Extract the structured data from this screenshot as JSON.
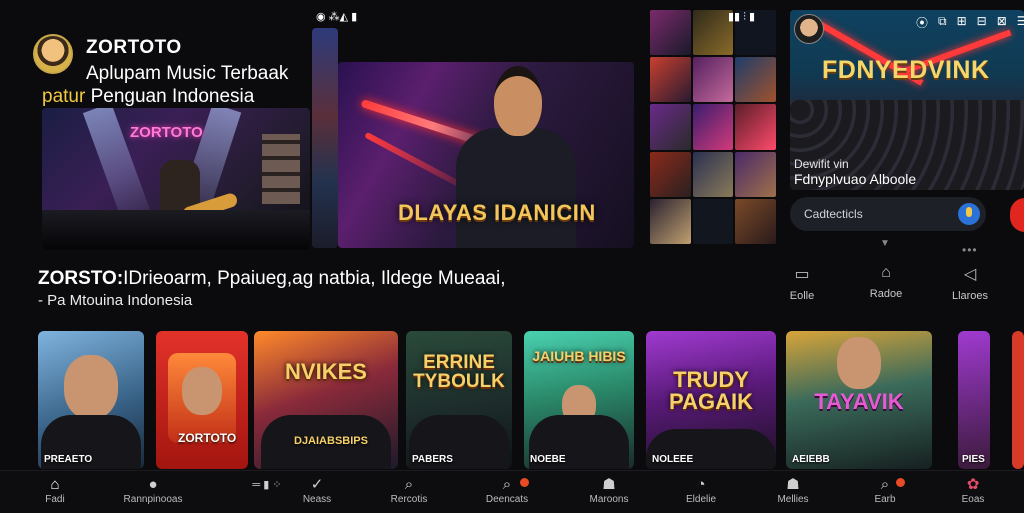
{
  "header": {
    "brand": "ZORTOTO",
    "tagline_1": "Aplupam Music Terbaak",
    "tagline_2_prefix": "patur",
    "tagline_2_rest": "Penguan Indonesia"
  },
  "hero_main": {
    "sign": "ZORTOTO"
  },
  "status_mid": "◉ ⁂◭ ▮",
  "hero_feature": {
    "title": "DLAYAS IDANICIN"
  },
  "status_grid": "▮▮ ⫶ ▮",
  "right_panel": {
    "banner": "FDNYEDVINK",
    "sub_1": "Dewifit vin",
    "sub_2": "Fdnyplvuao Alboole",
    "icons": [
      "⦿",
      "⧉",
      "⊞",
      "⊟",
      "⊠",
      "☰",
      "⊡"
    ],
    "search_placeholder": "Cadtecticls"
  },
  "quick_actions": [
    {
      "icon": "▭",
      "label": "Eolle"
    },
    {
      "icon": "⌂",
      "label": "Radoe"
    },
    {
      "icon": "◁",
      "label": "Llaroes"
    }
  ],
  "headline": {
    "brand": "ZORSTO:",
    "text": "IDrieoarm, Ppaiueg,ag natbia, Ildege Mueaai,",
    "line_2": "- Pa Mtouina Indonesia"
  },
  "tiles": [
    {
      "caption": "PREAETO",
      "big": ""
    },
    {
      "caption": "ZORTOTO",
      "big": ""
    },
    {
      "caption": "DJAIABSBIPS",
      "big": "NVIKES"
    },
    {
      "caption": "PABERS",
      "big": "ERRINE TYBOULK"
    },
    {
      "caption": "NOEBE",
      "big": "JAIUHB HIBIS"
    },
    {
      "caption": "NOLEEE",
      "big": "TRUDY PAGAIK"
    },
    {
      "caption": "AEIEBB",
      "big": "TAYAVIK"
    },
    {
      "caption": "PIES",
      "big": ""
    }
  ],
  "nav": [
    {
      "icon": "⌂",
      "label": "Fadi",
      "badge": false
    },
    {
      "icon": "●",
      "label": "Rannpinooas",
      "badge": false
    },
    {
      "icon": "═ ▮ ⁘",
      "label": "",
      "badge": false
    },
    {
      "icon": "✓",
      "label": "Neass",
      "badge": false
    },
    {
      "icon": "⌕",
      "label": "Rercotis",
      "badge": false
    },
    {
      "icon": "⌕",
      "label": "Deencats",
      "badge": true
    },
    {
      "icon": "☗",
      "label": "Maroons",
      "badge": false
    },
    {
      "icon": "◔",
      "label": "Eldelie",
      "badge": false
    },
    {
      "icon": "☗",
      "label": "Mellies",
      "badge": false
    },
    {
      "icon": "⌕",
      "label": "Earb",
      "badge": true
    },
    {
      "icon": "✿",
      "label": "Eoas",
      "badge": false
    }
  ]
}
